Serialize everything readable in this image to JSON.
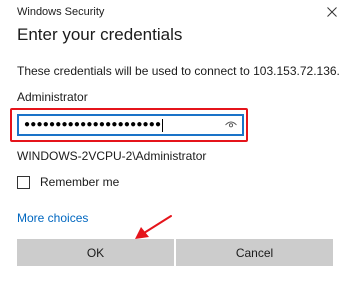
{
  "window": {
    "title": "Windows Security"
  },
  "dialog": {
    "heading": "Enter your credentials",
    "description": "These credentials will be used to connect to 103.153.72.136."
  },
  "credentials": {
    "username_label": "Administrator",
    "password_masked": "●●●●●●●●●●●●●●●●●●●●●●",
    "account": "WINDOWS-2VCPU-2\\Administrator"
  },
  "options": {
    "remember_label": "Remember me",
    "remember_checked": false,
    "more_choices": "More choices"
  },
  "buttons": {
    "ok": "OK",
    "cancel": "Cancel"
  },
  "colors": {
    "highlight": "#e5141b",
    "accent": "#0067c0",
    "button_bg": "#cccccc"
  },
  "icons": {
    "close": "close-icon",
    "reveal": "eye-icon",
    "annotation": "red-arrow"
  }
}
